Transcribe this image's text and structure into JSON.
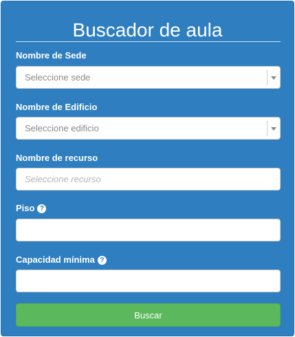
{
  "form": {
    "title": "Buscador de aula",
    "sede": {
      "label": "Nombre de Sede",
      "selected": "Seleccione sede"
    },
    "edificio": {
      "label": "Nombre de Edificio",
      "selected": "Seleccione edificio"
    },
    "recurso": {
      "label": "Nombre de recurso",
      "placeholder": "Seleccione recurso",
      "value": ""
    },
    "piso": {
      "label": "Piso",
      "help_icon": "question-circle-icon",
      "value": ""
    },
    "capacidad": {
      "label": "Capacidad mínima",
      "help_icon": "question-circle-icon",
      "value": ""
    },
    "submit_label": "Buscar"
  },
  "colors": {
    "panel_bg": "#2f7fc0",
    "button_bg": "#5cb85c",
    "text_light": "#ffffff"
  }
}
